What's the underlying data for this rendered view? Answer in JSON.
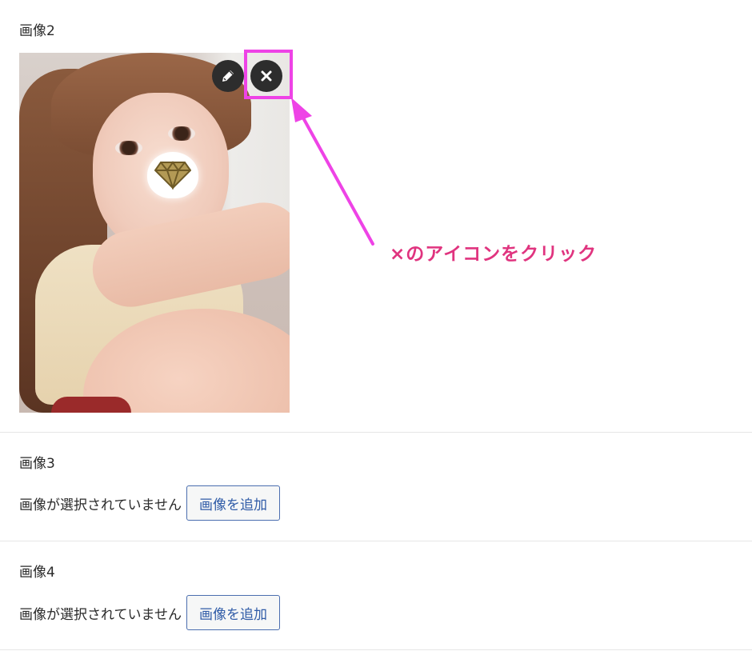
{
  "fields": [
    {
      "label": "画像2",
      "has_image": true
    },
    {
      "label": "画像3",
      "empty_text": "画像が選択されていません",
      "add_button_label": "画像を追加"
    },
    {
      "label": "画像4",
      "empty_text": "画像が選択されていません",
      "add_button_label": "画像を追加"
    }
  ],
  "image_controls": {
    "edit_icon": "pencil-icon",
    "remove_icon": "close-icon"
  },
  "annotation": {
    "text": "×のアイコンをクリック",
    "color": "#e0347f",
    "highlight_color": "#ee43e6"
  },
  "colors": {
    "button_text": "#2f5ba7",
    "button_border": "#4b6eaf",
    "icon_button_bg": "#2d2d2d"
  }
}
